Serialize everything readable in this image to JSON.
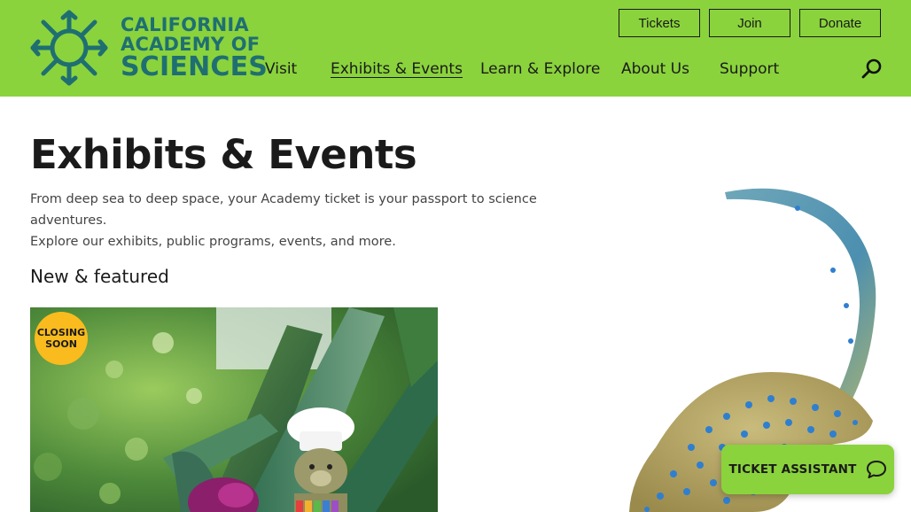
{
  "logo": {
    "line1": "CALIFORNIA",
    "line2": "ACADEMY OF",
    "line3": "SCIENCES"
  },
  "utility_nav": {
    "tickets": "Tickets",
    "join": "Join",
    "donate": "Donate"
  },
  "main_nav": {
    "items": [
      {
        "label": "Visit"
      },
      {
        "label": "Exhibits & Events"
      },
      {
        "label": "Learn & Explore"
      },
      {
        "label": "About Us"
      },
      {
        "label": "Support"
      }
    ],
    "active": "Exhibits & Events",
    "search_icon": "search-icon"
  },
  "page": {
    "title": "Exhibits & Events",
    "intro_line1": "From deep sea to deep space, your Academy ticket is your passport to science adventures.",
    "intro_line2": "Explore our exhibits, public programs, events, and more.",
    "section_heading": "New & featured"
  },
  "featured_card": {
    "badge_line1": "CLOSING",
    "badge_line2": "SOON"
  },
  "ticket_assistant": {
    "label": "TICKET ASSISTANT",
    "icon": "chat-bubble-icon"
  },
  "colors": {
    "header_green": "#8ad33c",
    "logo_teal": "#1f6f72",
    "badge_yellow": "#f9bb1d"
  }
}
